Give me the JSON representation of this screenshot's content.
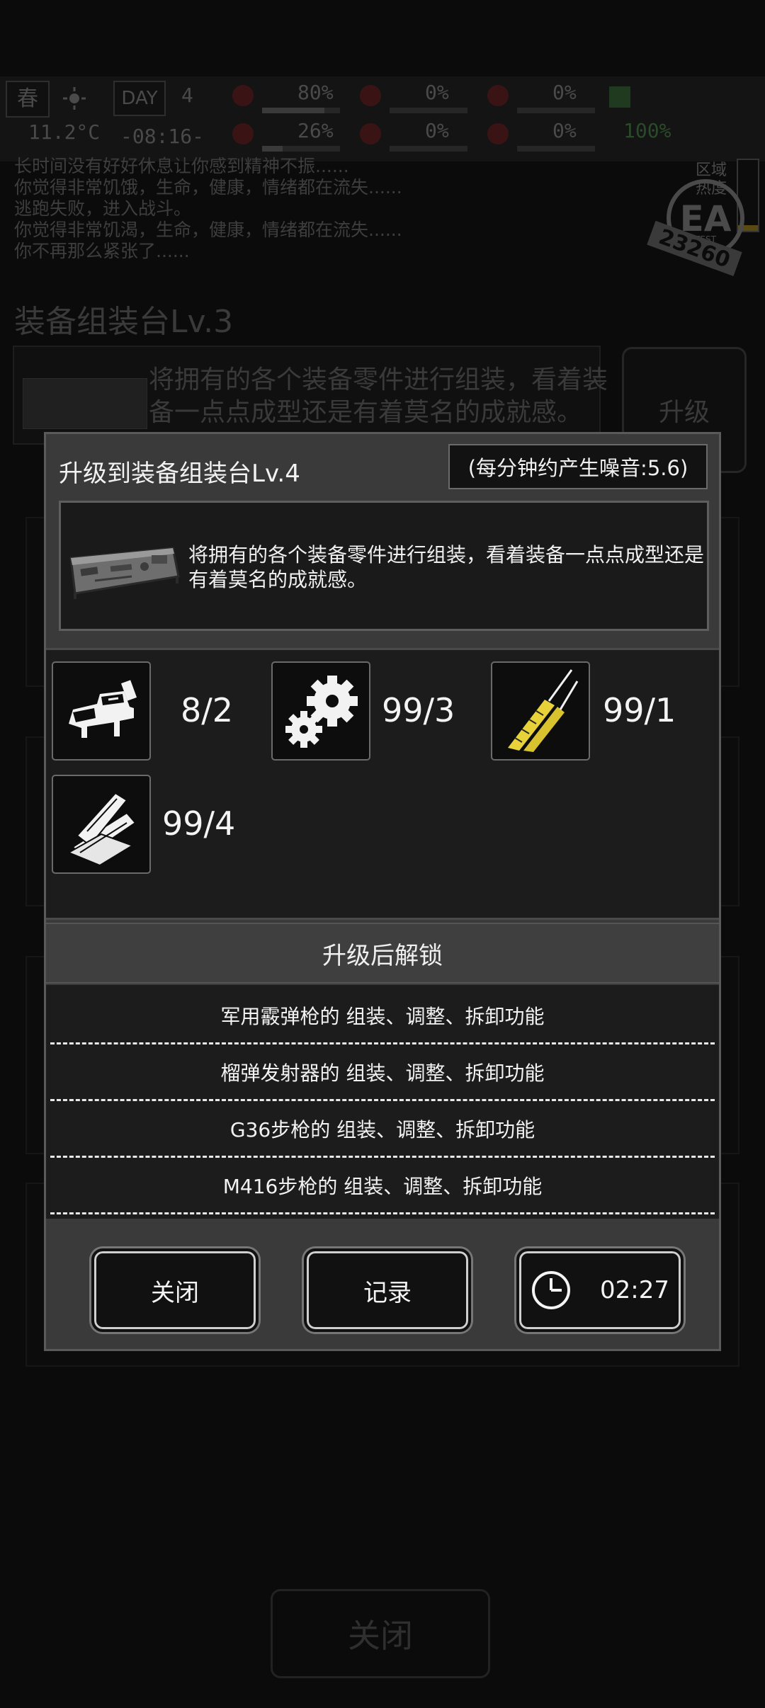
{
  "hud": {
    "season": "春",
    "temperature": "11.2°C",
    "day_label": "DAY",
    "day_number": "4",
    "time": "-08:16-",
    "stats": [
      {
        "name": "health-icon",
        "value": "80%",
        "fill": 0.8
      },
      {
        "name": "hunger-icon",
        "value": "0%",
        "fill": 0.0
      },
      {
        "name": "thirst-icon",
        "value": "0%",
        "fill": 0.0
      },
      {
        "name": "fatigue-icon",
        "value": "26%",
        "fill": 0.26
      },
      {
        "name": "blood-icon",
        "value": "0%",
        "fill": 0.0
      },
      {
        "name": "heart-icon",
        "value": "0%",
        "fill": 0.0
      },
      {
        "name": "noise-icon",
        "value": "0%",
        "fill": 0.0
      },
      {
        "name": "signal-icon",
        "value": "100%",
        "fill": 1.0
      }
    ],
    "zone_label": "区域\n热度"
  },
  "log": [
    "长时间没有好好休息让你感到精神不振......",
    "你觉得非常饥饿，生命，健康，情绪都在流失......",
    "逃跑失败，进入战斗。",
    "你觉得非常饥渴，生命，健康，情绪都在流失......",
    "你不再那么紧张了......"
  ],
  "stamp": {
    "text": "EA",
    "sub": "TEST",
    "number": "23260"
  },
  "background": {
    "title": "装备组装台Lv.3",
    "description": "将拥有的各个装备零件进行组装，看着装备一点点成型还是有着莫名的成就感。",
    "upgrade_label": "升级",
    "close_label": "关闭"
  },
  "modal": {
    "title": "升级到装备组装台Lv.4",
    "noise": "(每分钟约产生噪音:5.6)",
    "description": "将拥有的各个装备零件进行组装，看着装备一点点成型还是有着莫名的成就感。",
    "requirements": [
      {
        "icon": "vise-icon",
        "count": "8/2"
      },
      {
        "icon": "gears-icon",
        "count": "99/3"
      },
      {
        "icon": "wire-icon",
        "count": "99/1"
      },
      {
        "icon": "wood-planks-icon",
        "count": "99/4"
      }
    ],
    "unlock_header": "升级后解锁",
    "unlocks": [
      "军用霰弹枪的 组装、调整、拆卸功能",
      "榴弹发射器的 组装、调整、拆卸功能",
      "G36步枪的 组装、调整、拆卸功能",
      "M416步枪的 组装、调整、拆卸功能"
    ],
    "buttons": {
      "close": "关闭",
      "record": "记录",
      "timer": "02:27"
    }
  },
  "colors": {
    "modal_bg": "#3a3a3a",
    "panel_dark": "#1c1c1c",
    "wire_yellow": "#e8d23a",
    "text": "#f2f2f2"
  }
}
